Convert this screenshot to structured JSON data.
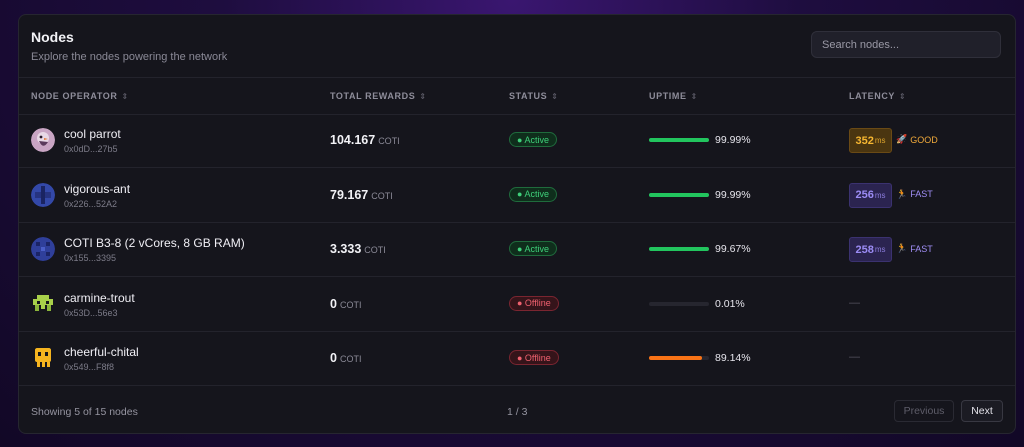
{
  "header": {
    "title": "Nodes",
    "subtitle": "Explore the nodes powering the network",
    "search_placeholder": "Search nodes..."
  },
  "columns": {
    "operator": "NODE OPERATOR",
    "rewards": "TOTAL REWARDS",
    "status": "STATUS",
    "uptime": "UPTIME",
    "latency": "LATENCY",
    "sort_icon": "⇕"
  },
  "rows": [
    {
      "name": "cool parrot",
      "address": "0x0dD...27b5",
      "reward": "104.167",
      "unit": "COTI",
      "status": "● Active",
      "status_kind": "active",
      "uptime": "99.99%",
      "uptime_pct": 99.99,
      "uptime_color": "#22c55e",
      "latency": "352",
      "latency_unit": "ms",
      "latency_kind": "good",
      "latency_label": "GOOD",
      "latency_icon": "🚀",
      "avatar": "parrot"
    },
    {
      "name": "vigorous-ant",
      "address": "0x226...52A2",
      "reward": "79.167",
      "unit": "COTI",
      "status": "● Active",
      "status_kind": "active",
      "uptime": "99.99%",
      "uptime_pct": 99.99,
      "uptime_color": "#22c55e",
      "latency": "256",
      "latency_unit": "ms",
      "latency_kind": "fast",
      "latency_label": "FAST",
      "latency_icon": "🏃",
      "avatar": "ant"
    },
    {
      "name": "COTI B3-8 (2 vCores, 8 GB RAM)",
      "address": "0x155...3395",
      "reward": "3.333",
      "unit": "COTI",
      "status": "● Active",
      "status_kind": "active",
      "uptime": "99.67%",
      "uptime_pct": 99.67,
      "uptime_color": "#22c55e",
      "latency": "258",
      "latency_unit": "ms",
      "latency_kind": "fast",
      "latency_label": "FAST",
      "latency_icon": "🏃",
      "avatar": "pixel-blue"
    },
    {
      "name": "carmine-trout",
      "address": "0x53D...56e3",
      "reward": "0",
      "unit": "COTI",
      "status": "● Offline",
      "status_kind": "offline",
      "uptime": "0.01%",
      "uptime_pct": 0.01,
      "uptime_color": "#22c55e",
      "latency": "—",
      "latency_kind": "none",
      "avatar": "pixel-green"
    },
    {
      "name": "cheerful-chital",
      "address": "0x549...F8f8",
      "reward": "0",
      "unit": "COTI",
      "status": "● Offline",
      "status_kind": "offline",
      "uptime": "89.14%",
      "uptime_pct": 89.14,
      "uptime_color": "#f97316",
      "latency": "—",
      "latency_kind": "none",
      "avatar": "pixel-yellow"
    }
  ],
  "footer": {
    "showing": "Showing 5 of 15 nodes",
    "page": "1 / 3",
    "prev": "Previous",
    "next": "Next"
  }
}
